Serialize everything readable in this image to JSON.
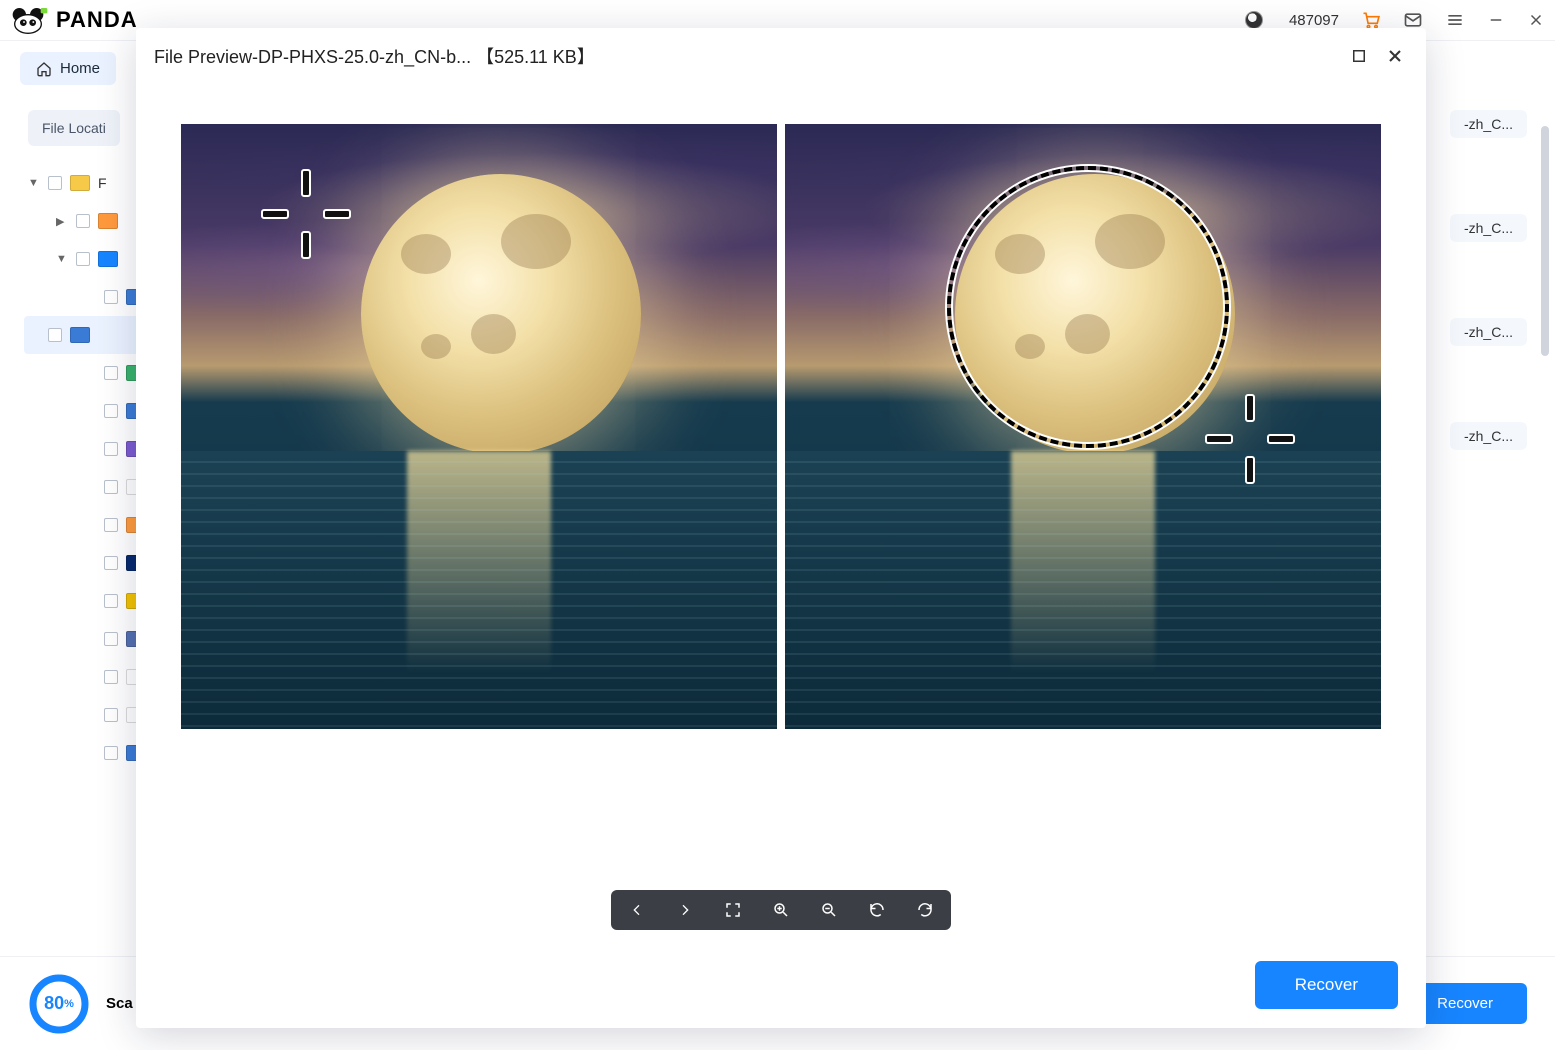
{
  "app": {
    "brand": "PANDA",
    "user_id": "487097"
  },
  "nav": {
    "home": "Home",
    "file_location": "File Locati"
  },
  "tree": {
    "root_label": "F",
    "items": [
      {
        "level": 1,
        "chev": "▼",
        "color": "#f7c948",
        "label": "F"
      },
      {
        "level": 2,
        "chev": "▶",
        "color": "#ff9a3c",
        "label": ""
      },
      {
        "level": 2,
        "chev": "▼",
        "color": "#1785ff",
        "label": ""
      },
      {
        "level": 3,
        "chev": "",
        "color": "#3a7bd5",
        "label": ""
      },
      {
        "level": 3,
        "chev": "",
        "color": "#3a7bd5",
        "label": "",
        "selected": true
      },
      {
        "level": 3,
        "chev": "",
        "color": "#38b26a",
        "label": ""
      },
      {
        "level": 3,
        "chev": "",
        "color": "#3a7bd5",
        "label": ""
      },
      {
        "level": 3,
        "chev": "",
        "color": "#7c5bd1",
        "label": ""
      },
      {
        "level": 3,
        "chev": "",
        "color": "#ffffff",
        "label": ""
      },
      {
        "level": 3,
        "chev": "",
        "color": "#ff9a3c",
        "label": ""
      },
      {
        "level": 3,
        "chev": "",
        "color": "#062a6e",
        "label": ""
      },
      {
        "level": 3,
        "chev": "",
        "color": "#f2c200",
        "label": ""
      },
      {
        "level": 3,
        "chev": "",
        "color": "#5470b0",
        "label": ""
      },
      {
        "level": 3,
        "chev": "",
        "color": "#ffffff",
        "label": ""
      },
      {
        "level": 3,
        "chev": "",
        "color": "#ffffff",
        "label": ""
      },
      {
        "level": 3,
        "chev": "",
        "color": "#3a7bd5",
        "label": ""
      }
    ]
  },
  "results": {
    "visible_suffix": [
      "-zh_C...",
      "-zh_C...",
      "-zh_C...",
      "-zh_C..."
    ]
  },
  "footer": {
    "progress_pct": "80",
    "progress_unit": "%",
    "scan_label": "Sca",
    "recover": "Recover"
  },
  "preview": {
    "title": "File Preview-DP-PHXS-25.0-zh_CN-b...  【525.11 KB】",
    "toolbar": {
      "prev": "prev",
      "next": "next",
      "fullscreen": "fullscreen",
      "zoom_in": "zoom-in",
      "zoom_out": "zoom-out",
      "rotate_ccw": "rotate-ccw",
      "rotate_cw": "rotate-cw"
    },
    "recover": "Recover"
  }
}
